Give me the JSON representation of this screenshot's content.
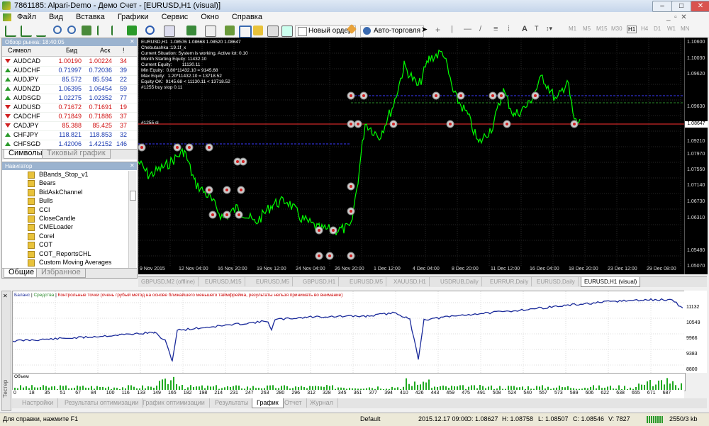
{
  "window": {
    "title": "7861185: Alpari-Demo - Демо Счет - [EURUSD,H1 (visual)]"
  },
  "menu": [
    "Файл",
    "Вид",
    "Вставка",
    "Графики",
    "Сервис",
    "Окно",
    "Справка"
  ],
  "toolbar": {
    "new_order": "Новый ордер",
    "autotrading": "Авто-торговля",
    "timeframes": [
      "M1",
      "M5",
      "M15",
      "M30",
      "H1",
      "H4",
      "D1",
      "W1",
      "MN"
    ]
  },
  "market_watch": {
    "header": "Обзор рынка: 18:40:05",
    "columns": [
      "Символ",
      "Бид",
      "Аск",
      "!"
    ],
    "rows": [
      {
        "symbol": "AUDCAD",
        "bid": "1.00190",
        "ask": "1.00224",
        "spread": "34",
        "dir": "down"
      },
      {
        "symbol": "AUDCHF",
        "bid": "0.71997",
        "ask": "0.72036",
        "spread": "39",
        "dir": "up"
      },
      {
        "symbol": "AUDJPY",
        "bid": "85.572",
        "ask": "85.594",
        "spread": "22",
        "dir": "up"
      },
      {
        "symbol": "AUDNZD",
        "bid": "1.06395",
        "ask": "1.06454",
        "spread": "59",
        "dir": "up"
      },
      {
        "symbol": "AUDSGD",
        "bid": "1.02275",
        "ask": "1.02352",
        "spread": "77",
        "dir": "up"
      },
      {
        "symbol": "AUDUSD",
        "bid": "0.71672",
        "ask": "0.71691",
        "spread": "19",
        "dir": "down"
      },
      {
        "symbol": "CADCHF",
        "bid": "0.71849",
        "ask": "0.71886",
        "spread": "37",
        "dir": "down"
      },
      {
        "symbol": "CADJPY",
        "bid": "85.388",
        "ask": "85.425",
        "spread": "37",
        "dir": "down"
      },
      {
        "symbol": "CHFJPY",
        "bid": "118.821",
        "ask": "118.853",
        "spread": "32",
        "dir": "up"
      },
      {
        "symbol": "CHFSGD",
        "bid": "1.42006",
        "ask": "1.42152",
        "spread": "146",
        "dir": "up"
      }
    ],
    "tabs": [
      "Символы",
      "Тиковый график"
    ]
  },
  "navigator": {
    "header": "Навигатор",
    "items": [
      "BBands_Stop_v1",
      "Bears",
      "BidAskChannel",
      "Bulls",
      "CCI",
      "CloseCandle",
      "CMELoader",
      "Corel",
      "COT",
      "COT_ReportsCHL",
      "Custom Moving Averages",
      "DeMark lines"
    ],
    "tabs": [
      "Общие",
      "Избранное"
    ]
  },
  "chart": {
    "info_lines": [
      "EURUSD,H1  1.08576 1.08668 1.08520 1.08647",
      "Chebutashka :19.1f_x",
      "Current Situation: System is working. Active lot: 0.10",
      "",
      "Month Starting Equity: 11432.10",
      "Current Equity:        11130.11",
      "Min Equity:  0.80*11432.10 = 9145.68",
      "Max Equity:  1.20*11432.10 = 13718.52",
      "Equity OK:  9145.68 < 11130.11 < 13718.52",
      "#1255 buy stop 0.11"
    ],
    "order_label": "#1255 sl",
    "current_price": "1.08647",
    "y_labels": [
      "1.10600",
      "1.09630",
      "1.09210",
      "1.08647",
      "1.07970",
      "1.07550",
      "1.07140",
      "1.06730",
      "1.06310",
      "1.05480",
      "1.05070"
    ],
    "y_label_top_extra": [
      "1.10030",
      "1.09620"
    ],
    "x_labels": [
      "9 Nov 2015",
      "12 Nov 04:00",
      "16 Nov 20:00",
      "19 Nov 12:00",
      "24 Nov 04:00",
      "26 Nov 20:00",
      "1 Dec 12:00",
      "4 Dec 04:00",
      "8 Dec 20:00",
      "11 Dec 12:00",
      "16 Dec 04:00",
      "18 Dec 20:00",
      "23 Dec 12:00",
      "29 Dec 08:00"
    ],
    "tabs": [
      "GBPUSD,M2 (offline)",
      "EURUSD,M15",
      "EURUSD,M5",
      "GBPUSD,H1",
      "EURUSD,M5",
      "XAUUSD,H1",
      "USDRUB,Daily",
      "EURRUR,Daily",
      "EURUSD,Daily",
      "EURUSD,H1 (visual)"
    ],
    "colors": {
      "price": "#00ff00",
      "background": "#000000",
      "grid": "#2a2a2a",
      "price_line": "#ff3030"
    }
  },
  "tester_graph": {
    "legend_balance": "Баланс",
    "legend_equity": "Средства",
    "legend_note": "Контрольные точки (очень грубый метод на основе ближайшего меньшего таймфрейма, результаты нельзя принимать во внимание)",
    "y_labels": [
      "11132",
      "10549",
      "9966",
      "9383",
      "8800"
    ],
    "volume_label": "Объем",
    "x_labels": [
      "0",
      "18",
      "35",
      "51",
      "67",
      "84",
      "100",
      "116",
      "133",
      "149",
      "165",
      "182",
      "198",
      "214",
      "231",
      "247",
      "263",
      "280",
      "296",
      "312",
      "328",
      "345",
      "361",
      "377",
      "394",
      "410",
      "426",
      "443",
      "459",
      "475",
      "491",
      "508",
      "524",
      "540",
      "557",
      "573",
      "589",
      "606",
      "622",
      "638",
      "655",
      "671",
      "687"
    ],
    "colors": {
      "balance": "#1a2a9a",
      "volume": "#22aa22"
    }
  },
  "bottom_tabs": [
    "Настройки",
    "Результаты оптимизации",
    "График оптимизации",
    "Результаты",
    "График",
    "Отчет",
    "Журнал"
  ],
  "side_label": "Тестер",
  "status": {
    "help": "Для справки, нажмите F1",
    "profile": "Default",
    "datetime": "2015.12.17 09:00",
    "open": "O: 1.08627",
    "high": "H: 1.08758",
    "low": "L: 1.08507",
    "close": "C: 1.08546",
    "volume": "V: 7827",
    "traffic": "2550/3 kb"
  }
}
